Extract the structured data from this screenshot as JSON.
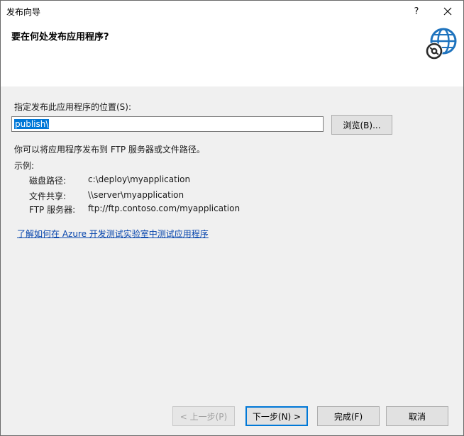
{
  "window": {
    "title": "发布向导",
    "help_glyph": "?",
    "close_icon": "close-icon"
  },
  "header": {
    "title": "要在何处发布应用程序?",
    "icon": "globe-disc-icon",
    "icon_color": "#1e73be"
  },
  "location": {
    "label": "指定发布此应用程序的位置(S):",
    "value": "publish\\",
    "browse_label": "浏览(B)..."
  },
  "hint": "你可以将应用程序发布到 FTP 服务器或文件路径。",
  "examples": {
    "heading": "示例:",
    "items": [
      {
        "key": "磁盘路径:",
        "value": "c:\\deploy\\myapplication"
      },
      {
        "key": "文件共享:",
        "value": "\\\\server\\myapplication"
      },
      {
        "key": "FTP 服务器:",
        "value": "ftp://ftp.contoso.com/myapplication"
      }
    ]
  },
  "link_text": "了解如何在 Azure 开发测试实验室中测试应用程序",
  "buttons": {
    "prev": "< 上一步(P)",
    "next": "下一步(N) >",
    "finish": "完成(F)",
    "cancel": "取消"
  },
  "colors": {
    "accent": "#0078d7",
    "link": "#0645ad",
    "selection": "#0078d7"
  }
}
